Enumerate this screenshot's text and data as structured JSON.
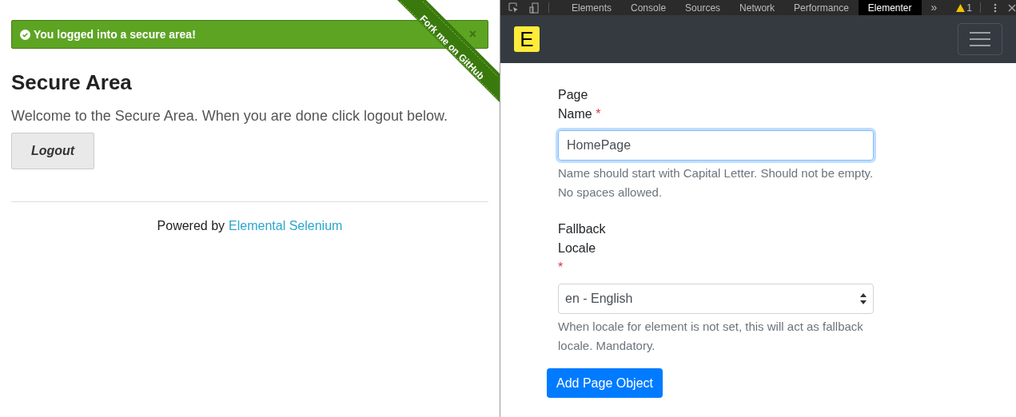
{
  "left": {
    "alert": {
      "message": "You logged into a secure area!",
      "close": "×"
    },
    "ribbon": "Fork me on GitHub",
    "heading": "Secure Area",
    "subheading": "Welcome to the Secure Area. When you are done click logout below.",
    "logout_button": "Logout",
    "footer": {
      "prefix": "Powered by",
      "link": "Elemental Selenium"
    }
  },
  "devtools": {
    "tabs": [
      {
        "label": "Elements",
        "selected": false
      },
      {
        "label": "Console",
        "selected": false
      },
      {
        "label": "Sources",
        "selected": false
      },
      {
        "label": "Network",
        "selected": false
      },
      {
        "label": "Performance",
        "selected": false
      },
      {
        "label": "Elementer",
        "selected": true
      }
    ],
    "more": "»",
    "warning_count": "1"
  },
  "elementer": {
    "logo": "E",
    "fields": [
      {
        "kind": "text",
        "label": "Page Name",
        "required_mark": "*",
        "value": "HomePage",
        "focused": true,
        "help": "Name should start with Capital Letter. Should not be empty. No spaces allowed."
      },
      {
        "kind": "select",
        "label": "Fallback Locale",
        "required_mark": "*",
        "value": "en - English",
        "focused": false,
        "help": "When locale for element is not set, this will act as fallback locale. Mandatory."
      }
    ],
    "submit_button": "Add Page Object"
  }
}
